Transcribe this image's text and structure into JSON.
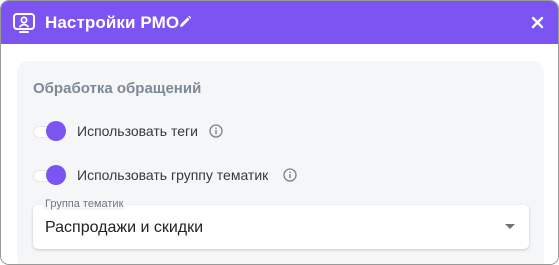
{
  "header": {
    "title": "Настройки РМО",
    "icons": {
      "app": "monitor-user-icon",
      "edit": "pencil-icon",
      "close": "close-icon"
    }
  },
  "section": {
    "title": "Обработка обращений",
    "toggles": [
      {
        "label": "Использовать теги",
        "checked": true,
        "info_icon": "info-icon"
      },
      {
        "label": "Использовать группу тематик",
        "checked": true,
        "info_icon": "info-icon"
      }
    ]
  },
  "topic_group": {
    "label": "Группа тематик",
    "value": "Распродажи и скидки",
    "arrow_icon": "arrow-drop-down-icon"
  },
  "colors": {
    "accent": "#7c54f2",
    "card_background": "#f5f6f8",
    "section_title": "#7d8a96"
  }
}
